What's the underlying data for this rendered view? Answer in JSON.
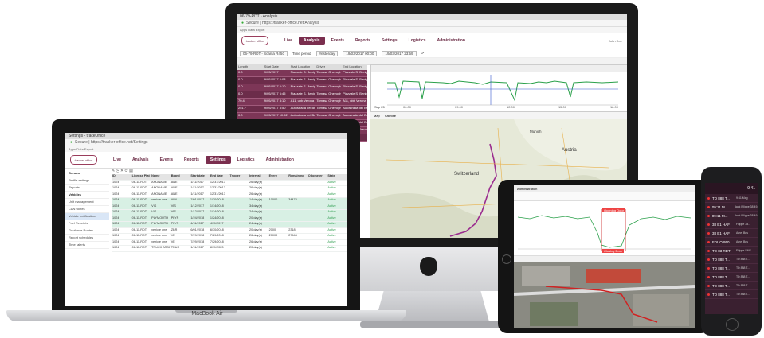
{
  "imac": {
    "tab_title": "06-79-RDT - Analysis",
    "url": "Secure | https://tracker-office.net/Analysis",
    "bookmarks": "Apps   Data Export   ",
    "logo": "tracker office",
    "nav": [
      "Live",
      "Analysis",
      "Events",
      "Reports",
      "Settings",
      "Logistics",
      "Administration"
    ],
    "nav_active": 1,
    "user": "John Doe",
    "filter_vehicle": "06-79-RDT - Scania R450",
    "filter_period_label": "Time period",
    "filter_period": "Yesterday",
    "filter_from": "19/03/2017 00:00",
    "filter_to": "19/03/2017 23:59",
    "table_headers": [
      "Length",
      "Start Date",
      "Start Location",
      "Driver",
      "End Location"
    ],
    "table_rows": [
      [
        "0.0",
        "9/05/2017",
        "Piazzale S. Benigno",
        "Tomasz Ghezoghe",
        "Piazzale S. Benigno"
      ],
      [
        "0.0",
        "9/05/2017 6:08",
        "Piazzale S. Benigno",
        "Tomasz Ghezoghe",
        "Piazzale S. Benigno"
      ],
      [
        "0.0",
        "9/05/2017 6:10",
        "Piazzale S. Benigno",
        "Tomasz Ghezoghe",
        "Piazzale S. Benigno"
      ],
      [
        "0.0",
        "9/05/2017 6:45",
        "Piazzale S. Benigno",
        "Tomasz Ghezoghe",
        "Piazzale S. Benigno"
      ],
      [
        "70.4",
        "9/05/2017 8:10",
        "A11, ubb Verona",
        "Tomasz Ghezoghe",
        "A11, ubb Verona"
      ],
      [
        "251.7",
        "9/05/2017 8:50",
        "Autostrada del Bre",
        "Tomasz Ghezoghe",
        "Autostrada del Bre"
      ],
      [
        "0.0",
        "9/05/2017 10:52",
        "Autostrada del Bre",
        "Tomasz Ghezoghe",
        "Autostrada del Bre"
      ],
      [
        "0.0",
        "9/05/2017 11:03",
        "Autostrada del Bre",
        "Tomasz Ghezoghe",
        "Autostrada del Bre"
      ],
      [
        "261.0",
        "9/05/2017 13:05",
        "Autostrada del Bre",
        "Tomasz Ghezoghe",
        "S31, Stadt Graubu"
      ],
      [
        "",
        "",
        "",
        "",
        ""
      ]
    ],
    "chart_label": "Sep 25",
    "chart_times": [
      "06:00",
      "09:00",
      "12:00",
      "15:00",
      "18:00"
    ],
    "map_tabs": [
      "Map",
      "Satellite"
    ],
    "map_labels": {
      "switzerland": "Switzerland",
      "austria": "Austria",
      "munich": "Munich",
      "slovenia": "Slovenia"
    }
  },
  "macbook": {
    "label": "MacBook Air",
    "tab_title": "Settings - trackOffice",
    "url": "Secure | https://tracker-office.net/Settings",
    "bookmarks": "Apps   Data Export   ",
    "logo": "tracker office",
    "nav": [
      "Live",
      "Analysis",
      "Events",
      "Reports",
      "Settings",
      "Logistics",
      "Administration"
    ],
    "nav_active": 4,
    "sidebar": [
      {
        "label": "General",
        "group": true
      },
      {
        "label": "Profile settings",
        "group": false
      },
      {
        "label": "Reports",
        "group": false
      },
      {
        "label": "Vehicles",
        "group": true
      },
      {
        "label": "Unit management",
        "group": false
      },
      {
        "label": "CAN routes",
        "group": false
      },
      {
        "label": "Vehicle notifications",
        "group": false
      },
      {
        "label": "Fuel Receipts",
        "group": false
      },
      {
        "label": "Geofence Routes",
        "group": false
      },
      {
        "label": "Report schedules",
        "group": false
      },
      {
        "label": "Timer alerts",
        "group": false
      }
    ],
    "sidebar_selected": 6,
    "grid_headers": [
      "ID",
      "License Plat",
      "Name",
      "Brand",
      "Start date",
      "End date",
      "Trigger",
      "Interval",
      "Every",
      "Remaining",
      "Odometer",
      "State"
    ],
    "grid_rows": [
      [
        "1024",
        "06-11-RDT",
        "ANONAME",
        "ANE",
        "1/11/2017",
        "12/31/2017",
        "",
        "26 day(s)",
        "",
        "",
        "",
        "Active"
      ],
      [
        "1024",
        "06-11-RDT",
        "ANONAME",
        "ANE",
        "1/11/2017",
        "12/31/2017",
        "",
        "26 day(s)",
        "",
        "",
        "",
        "Active"
      ],
      [
        "1024",
        "06-11-RDT",
        "ANONAME",
        "ANE",
        "1/11/2017",
        "12/31/2017",
        "",
        "26 day(s)",
        "",
        "",
        "",
        "Active"
      ],
      [
        "1024",
        "06-11-RDT",
        "vehicle one",
        "ALN",
        "7/01/2017",
        "1/30/2018",
        "",
        "14 day(s)",
        "10000",
        "34478",
        "",
        "Active"
      ],
      [
        "1024",
        "06-11-RDT",
        "VIS",
        "VIS",
        "1/12/2017",
        "1/14/2018",
        "",
        "34 day(s)",
        "",
        "",
        "",
        "Active"
      ],
      [
        "1024",
        "06-11-RDT",
        "VIS",
        "VIS",
        "1/12/2017",
        "1/14/2018",
        "",
        "24 day(s)",
        "",
        "",
        "",
        "Active"
      ],
      [
        "1024",
        "06-11-RDT",
        "PLYMOUTH",
        "PLYR",
        "1/24/2018",
        "1/24/2018",
        "",
        "20 day(s)",
        "",
        "",
        "",
        "Active"
      ],
      [
        "1024",
        "06-11-RDT",
        "PLYMOUTH",
        "PLYR",
        "4/11/2017",
        "4/11/2017",
        "",
        "24 day(s)",
        "",
        "",
        "",
        "Active"
      ],
      [
        "1024",
        "06-11-RDT",
        "vehicle one",
        "ZBR",
        "6/01/2018",
        "6/30/2018",
        "",
        "20 day(s)",
        "2000",
        "2318",
        "",
        "Active"
      ],
      [
        "1024",
        "06-11-RDT",
        "vehicle one",
        "VE",
        "7/29/2018",
        "7/29/2018",
        "",
        "26 day(s)",
        "20000",
        "27544",
        "",
        "Active"
      ],
      [
        "1024",
        "06-11-RDT",
        "vehicle one",
        "VE",
        "7/29/2018",
        "7/29/2018",
        "",
        "26 day(s)",
        "",
        "",
        "",
        "Active"
      ],
      [
        "1024",
        "06-11-RDT",
        "TRUCK ARDENIA",
        "TRUC",
        "1/11/2017",
        "8/11/2023",
        "",
        "20 day(s)",
        "",
        "",
        "",
        "Active"
      ]
    ],
    "grid_selected": [
      3,
      4,
      5,
      6,
      7
    ]
  },
  "ipad": {
    "tab_title": "Administration",
    "event_label_top": "Opening Door",
    "event_label_bottom": "Closing Door"
  },
  "phone": {
    "time": "9:41",
    "rows": [
      {
        "name": "TD 888 T...",
        "info": "9:41 Mag"
      },
      {
        "name": "09:11 M...",
        "info": "Back Filippe 38 49..."
      },
      {
        "name": "09:11 M...",
        "info": "Back Filippe 38 49..."
      },
      {
        "name": "38 E1 HAF",
        "info": "Filippe 38..."
      },
      {
        "name": "38 E1 HAF",
        "info": "Amel Bus"
      },
      {
        "name": "FDUO 950",
        "info": "Amel Bus"
      },
      {
        "name": "TD 83 RDT",
        "info": "Filippe SMS"
      },
      {
        "name": "TD 888 T...",
        "info": "TD 888 T..."
      },
      {
        "name": "TD 888 T...",
        "info": "TD 888 T..."
      },
      {
        "name": "TD 888 T...",
        "info": "TD 888 T..."
      },
      {
        "name": "TD 888 T...",
        "info": "TD 888 T..."
      },
      {
        "name": "TD 888 T...",
        "info": "TD 888 T..."
      }
    ]
  },
  "colors": {
    "brand": "#7a2e4e",
    "accent_green": "#2a9a4a",
    "route": "#9b2d8f"
  }
}
